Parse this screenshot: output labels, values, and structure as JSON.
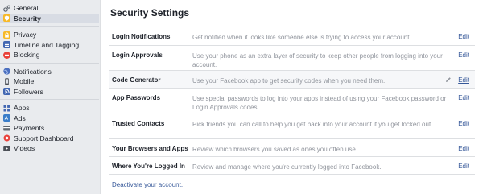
{
  "sidebar": {
    "groups": [
      [
        {
          "label": "General",
          "icon": "gears-icon"
        },
        {
          "label": "Security",
          "icon": "shield-icon",
          "active": true
        }
      ],
      [
        {
          "label": "Privacy",
          "icon": "lock-icon"
        },
        {
          "label": "Timeline and Tagging",
          "icon": "timeline-icon"
        },
        {
          "label": "Blocking",
          "icon": "block-icon"
        }
      ],
      [
        {
          "label": "Notifications",
          "icon": "globe-icon"
        },
        {
          "label": "Mobile",
          "icon": "mobile-icon"
        },
        {
          "label": "Followers",
          "icon": "rss-icon"
        }
      ],
      [
        {
          "label": "Apps",
          "icon": "apps-icon"
        },
        {
          "label": "Ads",
          "icon": "ads-icon"
        },
        {
          "label": "Payments",
          "icon": "payments-icon"
        },
        {
          "label": "Support Dashboard",
          "icon": "lifebuoy-icon"
        },
        {
          "label": "Videos",
          "icon": "videos-icon"
        }
      ]
    ]
  },
  "main": {
    "title": "Security Settings",
    "edit_label": "Edit",
    "rows": [
      {
        "label": "Login Notifications",
        "desc": "Get notified when it looks like someone else is trying to access your account."
      },
      {
        "label": "Login Approvals",
        "desc": "Use your phone as an extra layer of security to keep other people from logging into your account."
      },
      {
        "label": "Code Generator",
        "desc": "Use your Facebook app to get security codes when you need them.",
        "hover": true
      },
      {
        "label": "App Passwords",
        "desc": "Use special passwords to log into your apps instead of using your Facebook password or Login Approvals codes."
      },
      {
        "label": "Trusted Contacts",
        "desc": "Pick friends you can call to help you get back into your account if you get locked out."
      },
      {
        "label": "Your Browsers and Apps",
        "desc": "Review which browsers you saved as ones you often use."
      },
      {
        "label": "Where You're Logged In",
        "desc": "Review and manage where you're currently logged into Facebook."
      }
    ],
    "deactivate": "Deactivate your account."
  },
  "colors": {
    "link": "#365899",
    "sidebar_bg": "#e9ebee",
    "active_bg": "#d8dce4",
    "muted_text": "#90949c"
  }
}
